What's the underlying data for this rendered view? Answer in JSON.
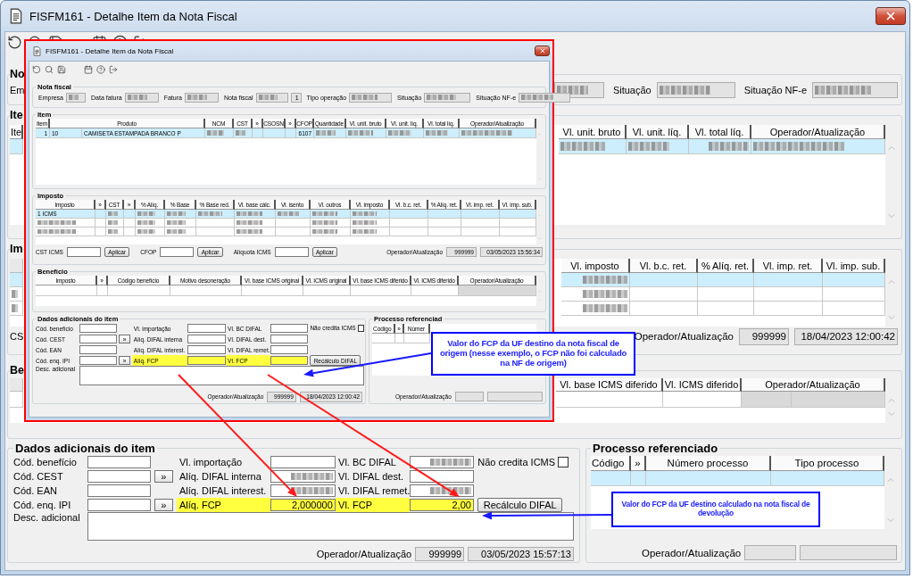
{
  "main_window": {
    "title": "FISFM161 - Detalhe Item da Nota Fiscal",
    "nota_fiscal": {
      "title": "No",
      "stub_label": "Em",
      "fields": [
        {
          "blurred": true
        },
        {
          "label": "Situação",
          "blurred": true
        },
        {
          "label": "Situação NF-e",
          "blurred": true
        }
      ]
    },
    "item": {
      "title": "Ite",
      "stub_column": "Ite",
      "columns": [
        "Vl. unit. bruto",
        "Vl. unit. líq.",
        "Vl. total líq.",
        "Operador/Atualização"
      ],
      "rows": [
        {
          "selected": true,
          "cells": [
            {},
            {
              "blurred": true
            },
            {
              "blurred": true
            },
            {
              "blurred": true
            },
            {
              "blurred": true
            }
          ]
        }
      ]
    },
    "imposto": {
      "title": "Im",
      "columns": [
        "Vl. imposto",
        "Vl. b.c. ret.",
        "% Alíq. ret.",
        "Vl. imp. ret.",
        "Vl. imp. sub."
      ],
      "rows": [
        {
          "selected": true,
          "cells": [
            {},
            {
              "blurred": true
            },
            {},
            {},
            {},
            {}
          ]
        },
        {
          "selected": false,
          "cells": [
            {
              "blurred": true
            },
            {
              "blurred": true
            },
            {},
            {},
            {},
            {}
          ]
        },
        {
          "selected": false,
          "cells": [
            {
              "blurred": true
            },
            {
              "blurred": true
            },
            {},
            {},
            {},
            {}
          ]
        }
      ],
      "footer": {
        "stub_label": "CS",
        "label": "Operador/Atualização",
        "operator": "999999",
        "timestamp": "18/04/2023 12:00:42"
      }
    },
    "beneficio": {
      "title": "Be",
      "columns": [
        "Vl. base ICMS diferido",
        "Vl. ICMS diferido",
        "Operador/Atualização"
      ],
      "rows": [
        {
          "selected": false,
          "cells": [
            {},
            {},
            {},
            {
              "disabled": true
            },
            {
              "disabled": true
            }
          ]
        }
      ]
    },
    "dados_adicionais": {
      "title": "Dados adicionais do item",
      "rows": [
        {
          "label": "Cód. benefício",
          "mid": {
            "label": "Vl. importação",
            "highlighted": false
          },
          "right": {
            "label": "Vl. BC DIFAL",
            "highlighted": false,
            "field": {
              "blurred": true
            }
          },
          "extra": {
            "kind": "checkbox",
            "label": "Não credita ICMS",
            "checked": false
          }
        },
        {
          "label": "Cód. CEST",
          "button": "»",
          "mid": {
            "label": "Alíq. DIFAL interna",
            "highlighted": false,
            "field": {
              "blurred": true
            }
          },
          "right": {
            "label": "Vl. DIFAL dest.",
            "highlighted": false
          }
        },
        {
          "label": "Cód. EAN",
          "mid": {
            "label": "Alíq. DIFAL interest.",
            "highlighted": false,
            "field": {
              "blurred": true
            }
          },
          "right": {
            "label": "Vl. DIFAL remet.",
            "highlighted": false,
            "field": {
              "blurred": true
            }
          }
        },
        {
          "label": "Cód. enq. IPI",
          "button": "»",
          "mid": {
            "label": "Alíq. FCP",
            "highlighted": true,
            "field": {
              "value": "2,000000"
            }
          },
          "right": {
            "label": "Vl. FCP",
            "highlighted": true,
            "field": {
              "value": "2,00"
            }
          },
          "extra": {
            "kind": "button",
            "label": "Recálculo DIFAL"
          }
        }
      ],
      "description_label": "Desc. adicional",
      "footer": {
        "label": "Operador/Atualização",
        "operator": "999999",
        "timestamp": "03/05/2023 15:57:13"
      }
    },
    "processo": {
      "title": "Processo referenciado",
      "columns": [
        "Código",
        "»",
        "Número processo",
        "Tipo processo"
      ],
      "rows": [
        {
          "selected": true
        }
      ],
      "footer": {
        "label": "Operador/Atualização"
      }
    }
  },
  "inset": {
    "title": "FISFM161 - Detalhe Item da Nota Fiscal",
    "nota_fiscal": {
      "title": "Nota fiscal",
      "fields": [
        {
          "label": "Empresa",
          "blurred": true
        },
        {
          "label": "Data fatura",
          "blurred": true
        },
        {
          "label": "Fatura",
          "blurred": true
        },
        {
          "label": "Nota fiscal",
          "blurred": true
        },
        {
          "value": "1"
        },
        {
          "label": "Tipo operação",
          "blurred": true
        },
        {
          "label": "Situação",
          "blurred": true
        },
        {
          "label": "Situação NF-e",
          "blurred": true
        }
      ]
    },
    "item": {
      "title": "Item",
      "columns": [
        "Item",
        "Produto",
        "NCM",
        "CST",
        "»",
        "CSOSN",
        "»",
        "CFOP",
        "Quantidade",
        "Vl. unit. bruto",
        "Vl. unit. líq.",
        "Vl. total líq.",
        "Operador/Atualização"
      ],
      "rows": [
        {
          "selected": true,
          "cells": [
            {
              "text": "1"
            },
            {
              "parts": [
                "10",
                "CAMISETA ESTAMPADA BRANCO P"
              ]
            },
            {
              "blurred": true
            },
            {
              "blurred": true
            },
            {},
            {},
            {},
            {
              "text": "6107"
            },
            {
              "blurred": true
            },
            {
              "blurred": true
            },
            {
              "blurred": true
            },
            {
              "blurred": true
            },
            {
              "blurred": true
            }
          ]
        }
      ]
    },
    "imposto": {
      "title": "Imposto",
      "columns": [
        "Imposto",
        "»",
        "CST",
        "»",
        "% Alíq.",
        "% Base",
        "% Base red.",
        "Vl. base cálc.",
        "Vl. isento",
        "Vl. outros",
        "Vl. imposto",
        "Vl. b.c. ret.",
        "% Alíq. ret.",
        "Vl. imp. ret.",
        "Vl. imp. sub."
      ],
      "rows": [
        {
          "selected": true,
          "cells": [
            {
              "text": "1 ICMS"
            },
            {},
            {
              "blurred": true
            },
            {},
            {
              "blurred": true
            },
            {
              "blurred": true
            },
            {
              "blurred": true
            },
            {
              "blurred": true
            },
            {
              "blurred": true
            },
            {
              "blurred": true
            },
            {
              "blurred": true
            },
            {},
            {},
            {},
            {}
          ]
        },
        {
          "selected": false,
          "cells": [
            {
              "blurred": true
            },
            {},
            {
              "blurred": true
            },
            {},
            {
              "blurred": true
            },
            {
              "blurred": true
            },
            {},
            {
              "blurred": true
            },
            {},
            {
              "blurred": true
            },
            {
              "blurred": true
            },
            {},
            {},
            {},
            {}
          ]
        },
        {
          "selected": false,
          "cells": [
            {
              "blurred": true
            },
            {},
            {
              "blurred": true
            },
            {},
            {
              "blurred": true
            },
            {
              "blurred": true
            },
            {},
            {
              "blurred": true
            },
            {},
            {
              "blurred": true
            },
            {
              "blurred": true
            },
            {},
            {},
            {},
            {}
          ]
        }
      ],
      "actions": [
        {
          "label": "CST ICMS",
          "button": "Aplicar"
        },
        {
          "label": "CFOP",
          "button": "Aplicar"
        },
        {
          "label": "Alíquota ICMS",
          "button": "Aplicar"
        }
      ],
      "footer": {
        "label": "Operador/Atualização",
        "operator": "999999",
        "timestamp": "03/05/2023 15:56:34"
      }
    },
    "beneficio": {
      "title": "Benefício",
      "columns": [
        "Imposto",
        "»",
        "Código benefício",
        "Motivo desoneração",
        "Vl. base ICMS original",
        "Vl. ICMS original",
        "Vl. base ICMS diferido",
        "Vl. ICMS diferido",
        "Operador/Atualização"
      ],
      "rows": [
        {
          "selected": false,
          "cells": [
            {},
            {},
            {},
            {},
            {},
            {},
            {},
            {},
            {
              "disabled": true
            }
          ]
        }
      ]
    },
    "dados_adicionais": {
      "title": "Dados adicionais do item",
      "rows": [
        {
          "label": "Cód. benefício",
          "mid": {
            "label": "Vl. importação",
            "highlighted": false
          },
          "right": {
            "label": "Vl. BC DIFAL",
            "highlighted": false
          },
          "extra": {
            "kind": "checkbox",
            "label": "Não credita ICMS",
            "checked": false
          }
        },
        {
          "label": "Cód. CEST",
          "button": "»",
          "mid": {
            "label": "Alíq. DIFAL interna",
            "highlighted": false
          },
          "right": {
            "label": "Vl. DIFAL dest.",
            "highlighted": false
          }
        },
        {
          "label": "Cód. EAN",
          "mid": {
            "label": "Alíq. DIFAL interest.",
            "highlighted": false
          },
          "right": {
            "label": "Vl. DIFAL remet.",
            "highlighted": false
          }
        },
        {
          "label": "Cód. enq. IPI",
          "button": "»",
          "mid": {
            "label": "Alíq. FCP",
            "highlighted": true
          },
          "right": {
            "label": "Vl. FCP",
            "highlighted": true
          },
          "extra": {
            "kind": "button",
            "label": "Recálculo DIFAL"
          }
        }
      ],
      "description_label": "Desc. adicional",
      "footer": {
        "label": "Operador/Atualização",
        "operator": "999999",
        "timestamp": "18/04/2023 12:00:42"
      }
    },
    "processo": {
      "title": "Processo referenciad",
      "columns": [
        "Código",
        "»",
        "Númer"
      ],
      "rows": [
        {
          "selected": false
        }
      ],
      "footer": {
        "label": "Operador/Atualização"
      }
    }
  },
  "callouts": [
    {
      "text": "Valor do FCP da UF destino da nota fiscal de origem (nesse exemplo, o FCP não foi calculado na NF de origem)"
    },
    {
      "text": "Valor do FCP da UF destino calculado na nota fiscal de devolução"
    }
  ]
}
